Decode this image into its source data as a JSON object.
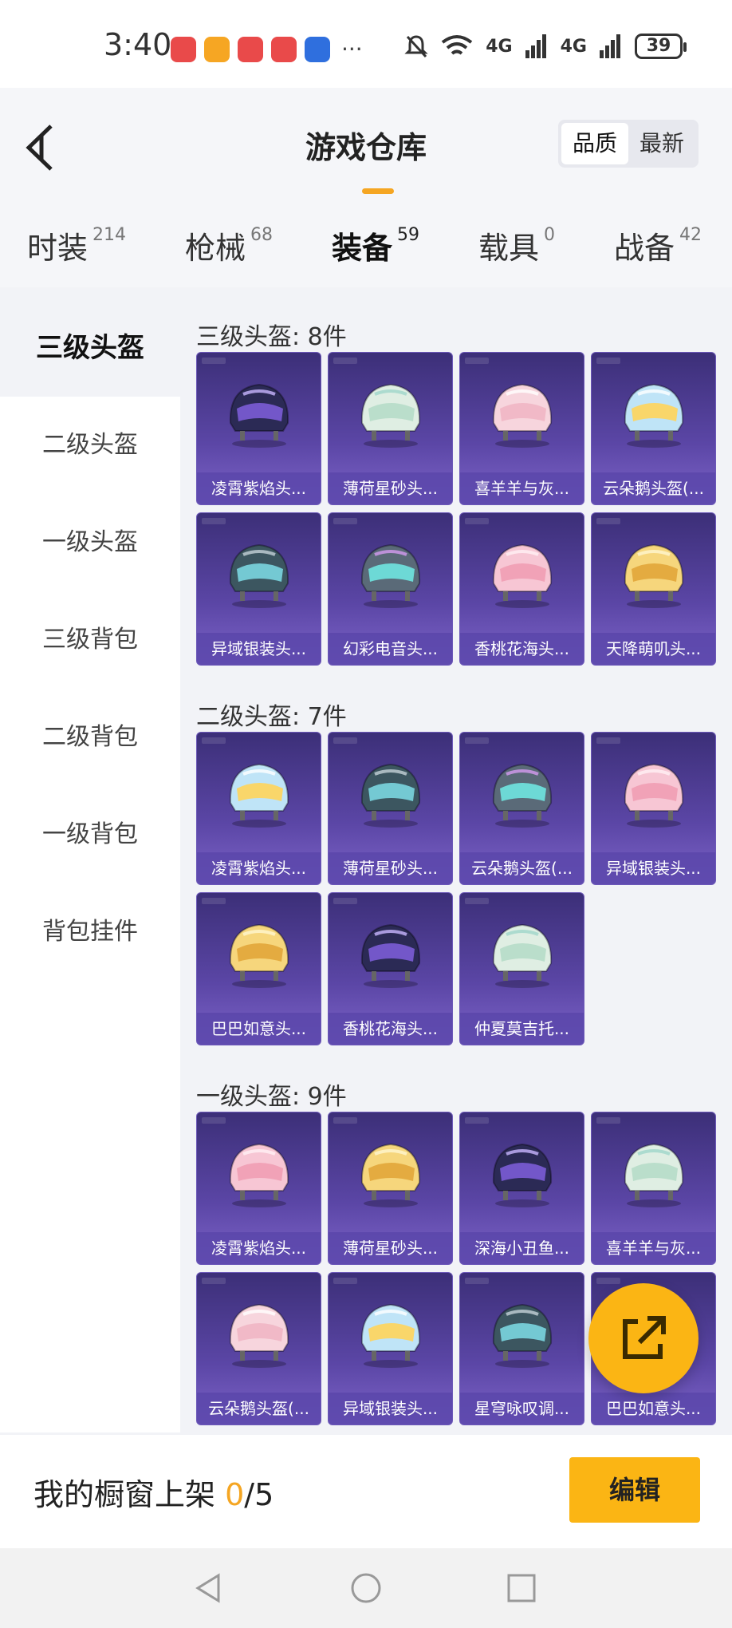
{
  "status": {
    "time": "3:40",
    "signal_1": "4G",
    "signal_2": "4G",
    "battery": "39",
    "app_colors": [
      "#e94a4a",
      "#f6a623",
      "#e94a4a",
      "#e94a4a",
      "#2f6fde"
    ]
  },
  "header": {
    "title": "游戏仓库",
    "sort_options": [
      "品质",
      "最新"
    ],
    "sort_active": "品质"
  },
  "tabs": [
    {
      "label": "时装",
      "count": "214"
    },
    {
      "label": "枪械",
      "count": "68"
    },
    {
      "label": "装备",
      "count": "59"
    },
    {
      "label": "载具",
      "count": "0"
    },
    {
      "label": "战备",
      "count": "42"
    }
  ],
  "sidebar": {
    "items": [
      "三级头盔",
      "二级头盔",
      "一级头盔",
      "三级背包",
      "二级背包",
      "一级背包",
      "背包挂件"
    ]
  },
  "sections": [
    {
      "title": "三级头盔: 8件",
      "items": [
        "凌霄紫焰头...",
        "薄荷星砂头...",
        "喜羊羊与灰...",
        "云朵鹅头盔(...",
        "异域银装头...",
        "幻彩电音头...",
        "香桃花海头...",
        "天降萌叽头..."
      ]
    },
    {
      "title": "二级头盔: 7件",
      "items": [
        "凌霄紫焰头...",
        "薄荷星砂头...",
        "云朵鹅头盔(...",
        "异域银装头...",
        "巴巴如意头...",
        "香桃花海头...",
        "仲夏莫吉托..."
      ]
    },
    {
      "title": "一级头盔: 9件",
      "items": [
        "凌霄紫焰头...",
        "薄荷星砂头...",
        "深海小丑鱼...",
        "喜羊羊与灰...",
        "云朵鹅头盔(...",
        "异域银装头...",
        "星穹咏叹调...",
        "巴巴如意头..."
      ]
    }
  ],
  "bottom": {
    "showcase_label": "我的橱窗上架",
    "showcase_count": "0",
    "showcase_total": "/5",
    "edit_label": "编辑"
  },
  "colors": {
    "accent": "#fbb514",
    "card_bg": "#5b46a6"
  }
}
